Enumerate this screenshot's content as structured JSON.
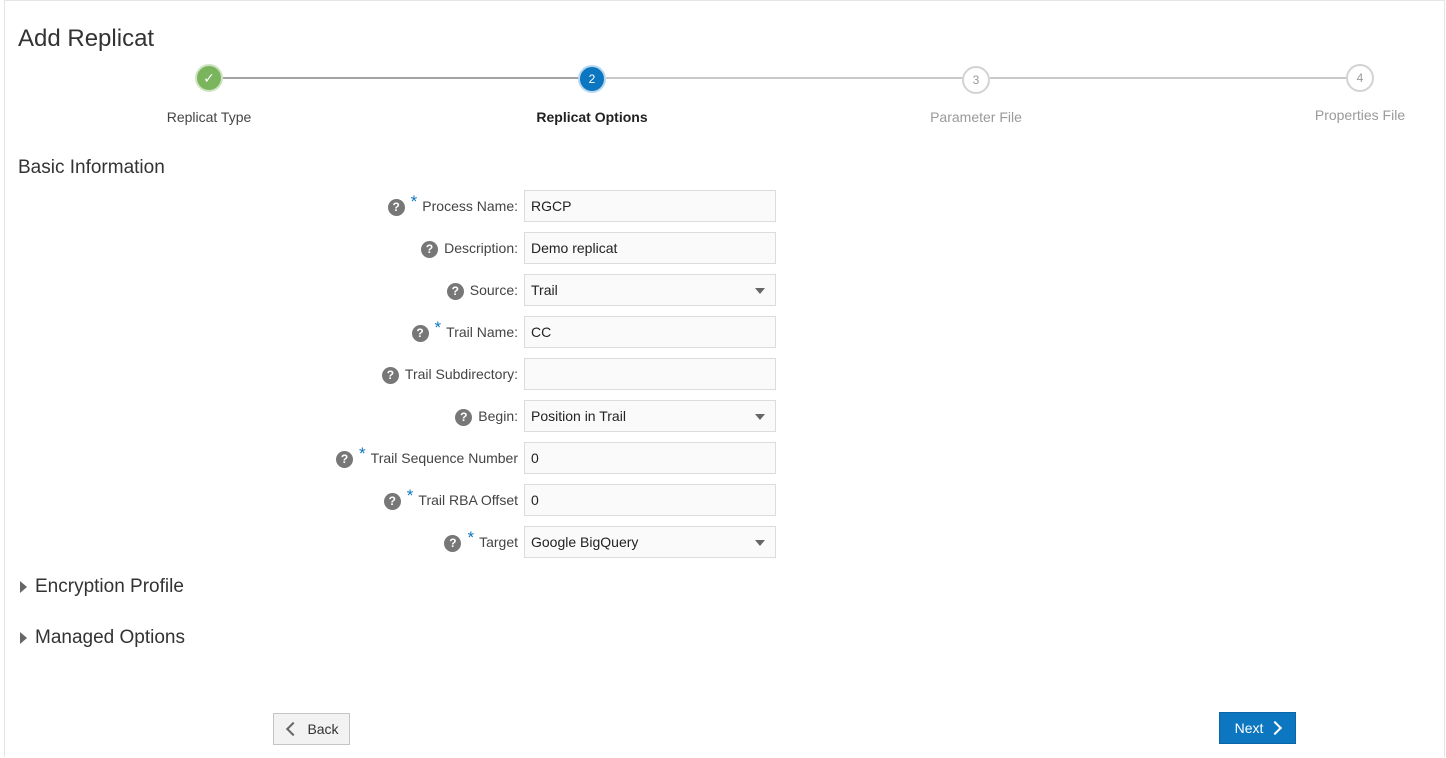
{
  "page": {
    "title": "Add Replicat"
  },
  "stepper": {
    "steps": [
      {
        "number": "1",
        "label": "Replicat Type",
        "state": "completed"
      },
      {
        "number": "2",
        "label": "Replicat Options",
        "state": "current"
      },
      {
        "number": "3",
        "label": "Parameter File",
        "state": "pending"
      },
      {
        "number": "4",
        "label": "Properties File",
        "state": "pending"
      }
    ],
    "completed_glyph": "✓"
  },
  "basic_info": {
    "title": "Basic Information",
    "help_glyph": "?",
    "required_glyph": "*",
    "fields": {
      "process_name": {
        "label": "Process Name:",
        "value": "RGCP",
        "required": true
      },
      "description": {
        "label": "Description:",
        "value": "Demo replicat",
        "required": false
      },
      "source": {
        "label": "Source:",
        "value": "Trail",
        "required": false
      },
      "trail_name": {
        "label": "Trail Name:",
        "value": "CC",
        "required": true
      },
      "trail_subdirectory": {
        "label": "Trail Subdirectory:",
        "value": "",
        "required": false
      },
      "begin": {
        "label": "Begin:",
        "value": "Position in Trail",
        "required": false
      },
      "trail_sequence_number": {
        "label": "Trail Sequence Number",
        "value": "0",
        "required": true
      },
      "trail_rba_offset": {
        "label": "Trail RBA Offset",
        "value": "0",
        "required": true
      },
      "target": {
        "label": "Target",
        "value": "Google BigQuery",
        "required": true
      }
    }
  },
  "sections": {
    "encryption_profile": "Encryption Profile",
    "managed_options": "Managed Options"
  },
  "buttons": {
    "back": "Back",
    "next": "Next"
  },
  "colors": {
    "accent": "#0c76c0",
    "completed": "#7ab45c"
  },
  "icons": {
    "help": "help-circle-icon",
    "back": "chevron-left-icon",
    "next": "chevron-right-icon",
    "collapsed": "triangle-right-icon",
    "dropdown": "caret-down-icon",
    "done": "checkmark-icon"
  }
}
